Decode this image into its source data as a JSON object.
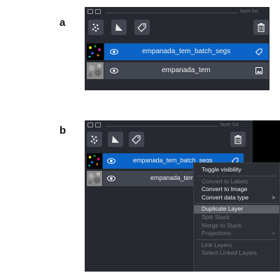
{
  "figure": {
    "label_a": "a",
    "label_b": "b"
  },
  "panel_a": {
    "header_title": "layer list",
    "toolbar": {
      "points_icon": "points-icon",
      "shapes_icon": "shapes-icon",
      "labels_icon": "labels-icon",
      "delete_icon": "trash-icon"
    },
    "layers": [
      {
        "name": "empanada_tem_batch_segs",
        "selected": true,
        "type_icon": "label-tag-icon"
      },
      {
        "name": "empanada_tem",
        "selected": false,
        "type_icon": "image-icon"
      }
    ]
  },
  "panel_b": {
    "header_title": "layer list",
    "layers": [
      {
        "name": "empanada_tem_batch_segs",
        "selected": true,
        "type_icon": "label-tag-icon"
      },
      {
        "name": "empanada_tem",
        "selected": false,
        "type_icon": "image-icon"
      }
    ],
    "context_menu": {
      "toggle_visibility": "Toggle visibility",
      "convert_to_labels": "Convert to Labels",
      "convert_to_image": "Convert to Image",
      "convert_data_type": "Convert data type",
      "duplicate_layer": "Duplicate Layer",
      "split_stack": "Split Stack",
      "merge_to_stack": "Merge to Stack",
      "projections": "Projections",
      "link_layers": "Link Layers",
      "select_linked_layers": "Select Linked Layers"
    }
  },
  "colors": {
    "panel_bg": "#262930",
    "button_bg": "#414650",
    "selected_row": "#0b64c7",
    "menu_bg": "#2c2f35",
    "menu_highlight": "#5c6068",
    "disabled_text": "#74777e"
  }
}
